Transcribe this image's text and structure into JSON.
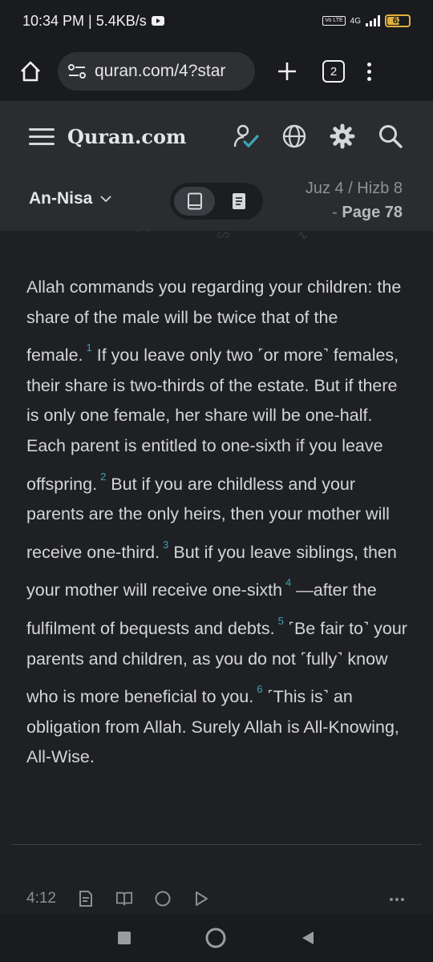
{
  "status_bar": {
    "time_speed": "10:34 PM | 5.4KB/s",
    "network": "4G",
    "volte": "Vo LTE",
    "battery": "62",
    "battery_level_percent": 62
  },
  "browser": {
    "url": "quran.com/4?star",
    "tab_count": "2"
  },
  "site": {
    "logo": "Quran.com"
  },
  "sub_header": {
    "surah": "An-Nisa",
    "juz_hizb": "Juz 4 / Hizb 8",
    "page_prefix": "- ",
    "page": "Page 78"
  },
  "verse": {
    "segments": [
      "Allah commands you regarding your children: the share of the male will be twice that of the female.",
      "If you leave only two ˹or more˺ females, their share is two-thirds of the estate. But if there is only one female, her share will be one-half. Each parent is entitled to one-sixth if you leave offspring.",
      "But if you are childless and your parents are the only heirs, then your mother will receive one-third.",
      "But if you leave siblings, then your mother will receive one-sixth",
      "—after the fulfilment of bequests and debts.",
      "˹Be fair to˺ your parents and children, as you do not ˹fully˺ know who is more beneficial to you.",
      "˹This is˺ an obligation from Allah. Surely Allah is All-Knowing, All-Wise."
    ],
    "footnotes": [
      "1",
      "2",
      "3",
      "4",
      "5",
      "6"
    ],
    "verse_key": "4:12"
  },
  "colors": {
    "background": "#1f2023",
    "header": "#2a2c30",
    "footnote": "#3fa3b5",
    "battery": "#e0b13a",
    "check": "#3fa3b5"
  },
  "icons": {
    "browser": [
      "home-icon",
      "site-settings-icon",
      "plus-icon",
      "tabs-icon",
      "more-vertical-icon"
    ],
    "header": [
      "hamburger-icon",
      "user-check-icon",
      "globe-icon",
      "gear-icon",
      "search-icon"
    ],
    "modes": [
      "book-icon",
      "document-icon"
    ],
    "verse_actions": [
      "notes-icon",
      "book-open-icon",
      "chat-icon",
      "play-icon",
      "more-horizontal-icon"
    ],
    "system_nav": [
      "recents-square-icon",
      "home-circle-icon",
      "back-triangle-icon"
    ]
  }
}
